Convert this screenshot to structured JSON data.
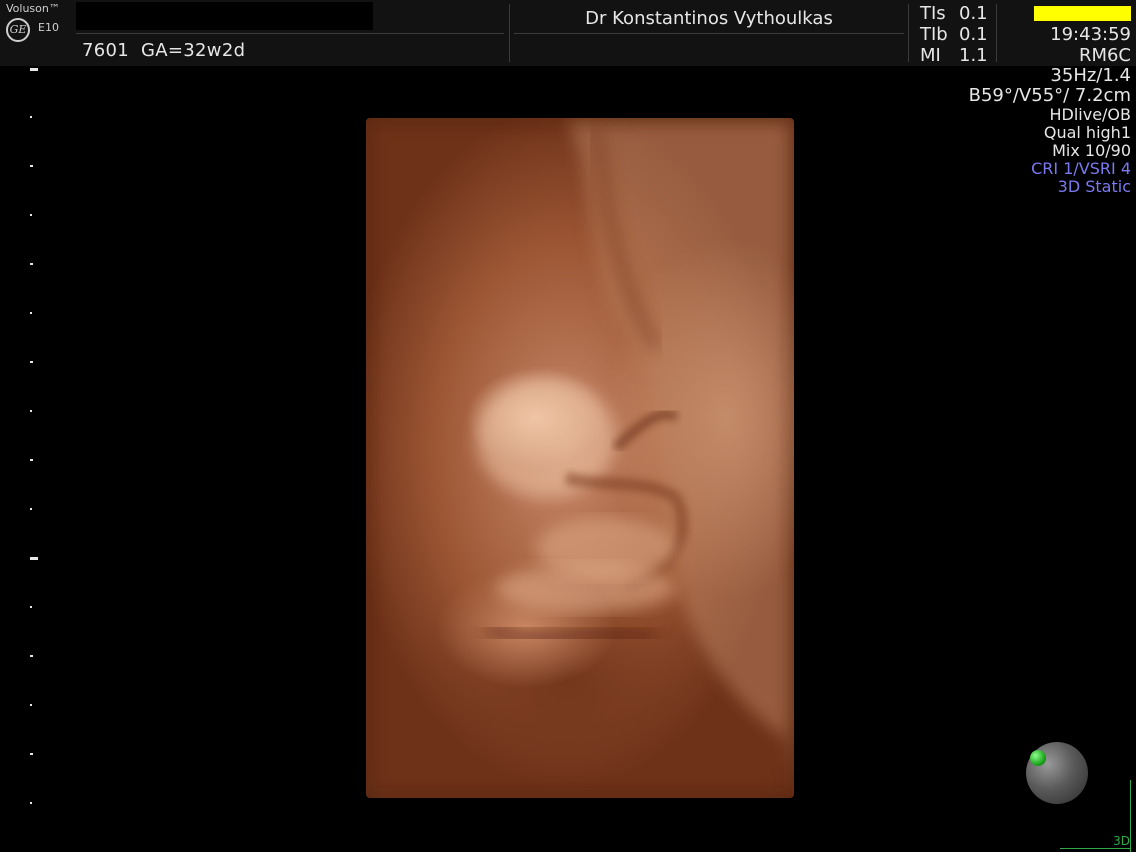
{
  "header": {
    "brand": "Voluson™",
    "logo_text": "GE",
    "model": "E10",
    "patient_info": "7601  GA=32w2d",
    "doctor": "Dr Konstantinos Vythoulkas",
    "params": [
      {
        "label": "TIs",
        "value": "0.1"
      },
      {
        "label": "TIb",
        "value": "0.1"
      },
      {
        "label": "MI",
        "value": "1.1"
      }
    ],
    "time": "19:43:59",
    "probe": "RM6C"
  },
  "info": {
    "frame_rate": "35Hz/1.4",
    "geometry": "B59°/V55°/ 7.2cm",
    "render_mode": "HDlive/OB",
    "quality": "Qual high1",
    "mix": "Mix 10/90",
    "cri": "CRI 1/VSRI 4",
    "mode": "3D Static"
  },
  "footer": {
    "mode_indicator": "3D"
  },
  "colors": {
    "background": "#000000",
    "header": "#121212",
    "yellow_bar": "#ffff00",
    "accent_blue": "#7a7af0",
    "accent_green": "#2fa84a"
  }
}
